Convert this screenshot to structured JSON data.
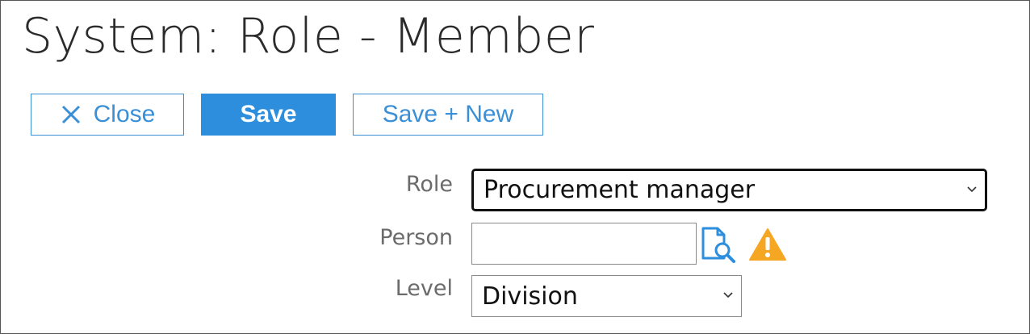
{
  "page": {
    "title": "System: Role - Member"
  },
  "toolbar": {
    "close_label": "Close",
    "save_label": "Save",
    "save_new_label": "Save + New"
  },
  "form": {
    "role": {
      "label": "Role",
      "value": "Procurement manager"
    },
    "person": {
      "label": "Person",
      "value": "",
      "lookup_icon": "document-search-icon",
      "warning_icon": "warning-triangle-icon"
    },
    "level": {
      "label": "Level",
      "value": "Division"
    }
  },
  "colors": {
    "accent": "#2e8ede",
    "warning": "#f5a623"
  }
}
